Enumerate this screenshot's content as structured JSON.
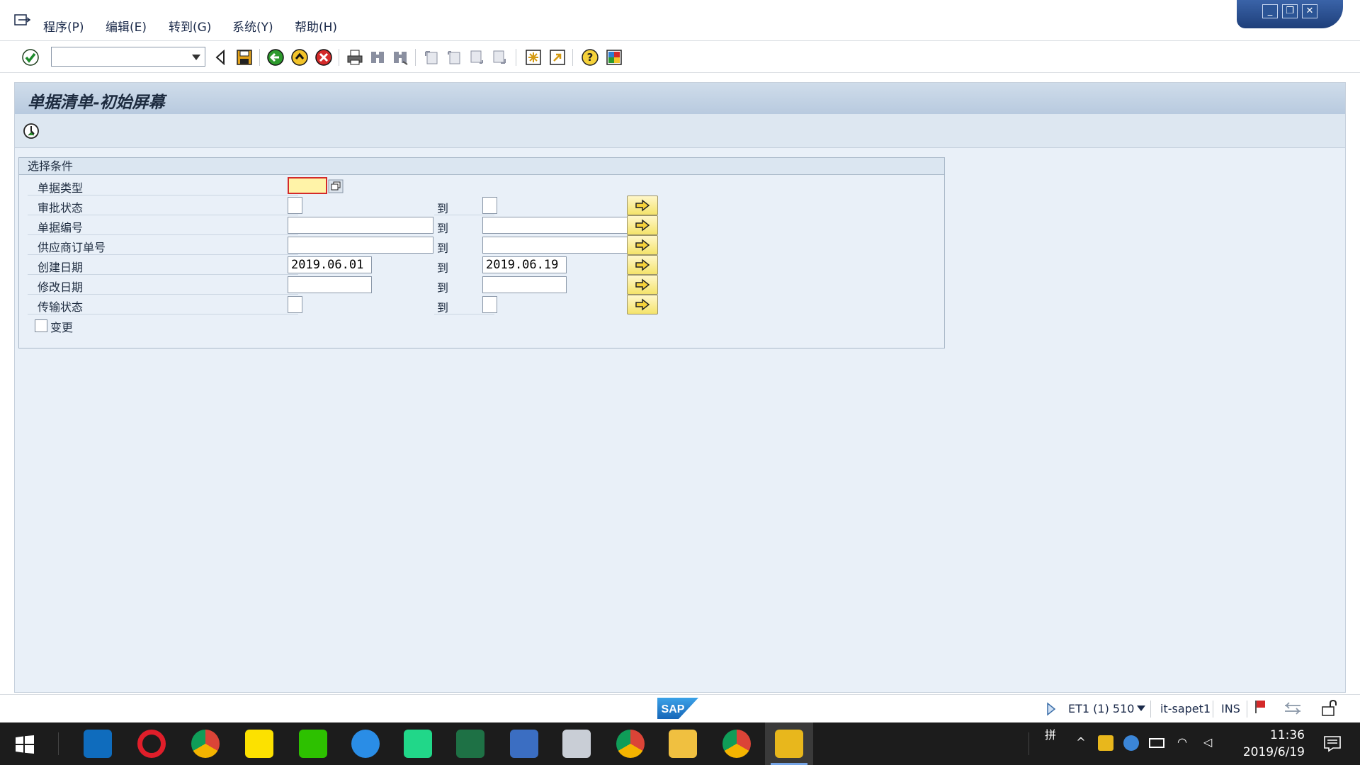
{
  "menu": {
    "items": [
      "程序(P)",
      "编辑(E)",
      "转到(G)",
      "系统(Y)",
      "帮助(H)"
    ]
  },
  "toolbar": {
    "command_field_value": "",
    "icons": [
      "enter-icon",
      "back-icon",
      "save-icon",
      "back-green-icon",
      "exit-icon",
      "cancel-icon",
      "print-icon",
      "find-icon",
      "find-next-icon",
      "first-page-icon",
      "prev-page-icon",
      "next-page-icon",
      "last-page-icon",
      "create-session-icon",
      "shortcut-icon",
      "help-icon",
      "layout-icon"
    ]
  },
  "screen": {
    "title": "单据清单-初始屏幕",
    "selection_box_title": "选择条件",
    "to_label": "到",
    "fields": [
      {
        "label": "单据类型",
        "from": "",
        "to": null
      },
      {
        "label": "审批状态",
        "from": "",
        "to": ""
      },
      {
        "label": "单据编号",
        "from": "",
        "to": ""
      },
      {
        "label": "供应商订单号",
        "from": "",
        "to": ""
      },
      {
        "label": "创建日期",
        "from": "2019.06.01",
        "to": "2019.06.19"
      },
      {
        "label": "修改日期",
        "from": "",
        "to": ""
      },
      {
        "label": "传输状态",
        "from": "",
        "to": ""
      }
    ],
    "checkbox_label": "变更"
  },
  "status": {
    "system": "ET1 (1) 510",
    "server": "it-sapet1",
    "mode": "INS",
    "logo": "SAP"
  },
  "taskbar": {
    "time": "11:36",
    "date": "2019/6/19",
    "ime": "拼"
  },
  "colors": {
    "main_bg": "#e9f0f8",
    "title_bar": "#c4d4e6",
    "arrow_button": "#f4e36a",
    "required_field": "#fff3a8",
    "taskbar": "#1c1c1c"
  }
}
